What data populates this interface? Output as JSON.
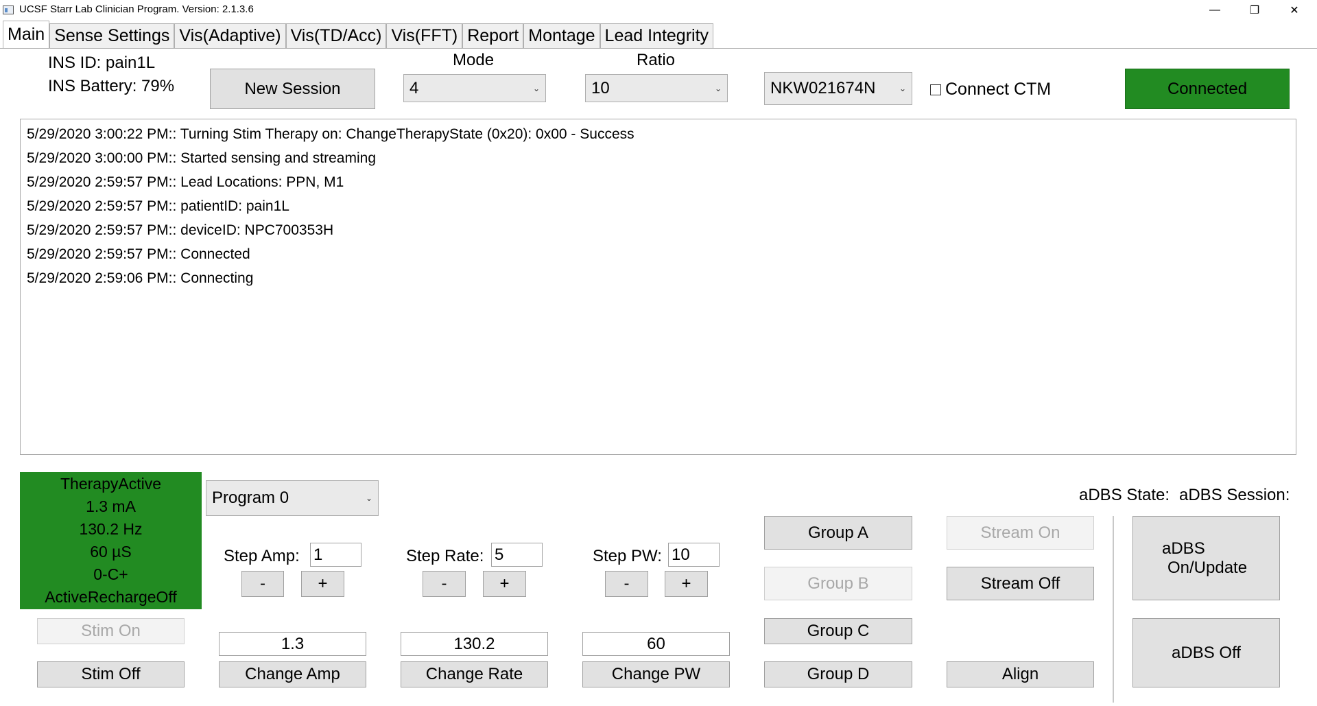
{
  "window": {
    "title": "UCSF Starr Lab Clinician Program. Version: 2.1.3.6",
    "minimize": "—",
    "restore": "❐",
    "close": "✕"
  },
  "tabs": [
    "Main",
    "Sense Settings",
    "Vis(Adaptive)",
    "Vis(TD/Acc)",
    "Vis(FFT)",
    "Report",
    "Montage",
    "Lead Integrity"
  ],
  "header": {
    "ins_id": "INS ID: pain1L",
    "ins_battery": "INS Battery: 79%",
    "new_session": "New Session",
    "mode_label": "Mode",
    "mode_value": "4",
    "ratio_label": "Ratio",
    "ratio_value": "10",
    "ctm_device": "NKW021674N",
    "connect_ctm": "Connect CTM",
    "connect_ctm_checked": false,
    "connected": "Connected",
    "connected_color": "#228b22"
  },
  "log": [
    "5/29/2020 3:00:22 PM:: Turning Stim Therapy on: ChangeTherapyState (0x20): 0x00 - Success",
    "5/29/2020 3:00:00 PM:: Started sensing and streaming",
    "5/29/2020 2:59:57 PM:: Lead Locations: PPN, M1",
    "5/29/2020 2:59:57 PM:: patientID: pain1L",
    "5/29/2020 2:59:57 PM:: deviceID: NPC700353H",
    "5/29/2020 2:59:57 PM:: Connected",
    "5/29/2020 2:59:06 PM:: Connecting"
  ],
  "therapy": {
    "state": "TherapyActive",
    "amp": "1.3  mA",
    "rate": "130.2   Hz",
    "pw": "60   µS",
    "electrodes": "0-C+",
    "recharge": "ActiveRechargeOff",
    "color": "#228b22"
  },
  "program": "Program 0",
  "stim": {
    "on": "Stim On",
    "off": "Stim Off"
  },
  "amp": {
    "step_label": "Step Amp:",
    "step_value": "1",
    "minus": "-",
    "plus": "+",
    "value": "1.3",
    "change": "Change Amp"
  },
  "rate": {
    "step_label": "Step Rate:",
    "step_value": "5",
    "minus": "-",
    "plus": "+",
    "value": "130.2",
    "change": "Change Rate"
  },
  "pw": {
    "step_label": "Step PW:",
    "step_value": "10",
    "minus": "-",
    "plus": "+",
    "value": "60",
    "change": "Change PW"
  },
  "groups": {
    "a": "Group A",
    "b": "Group B",
    "c": "Group C",
    "d": "Group D"
  },
  "stream": {
    "on": "Stream On",
    "off": "Stream Off"
  },
  "align": "Align",
  "adbs": {
    "state_label": "aDBS State:",
    "session_label": "aDBS Session:",
    "on_update_line1": "aDBS",
    "on_update_line2": "On/Update",
    "off": "aDBS Off"
  }
}
